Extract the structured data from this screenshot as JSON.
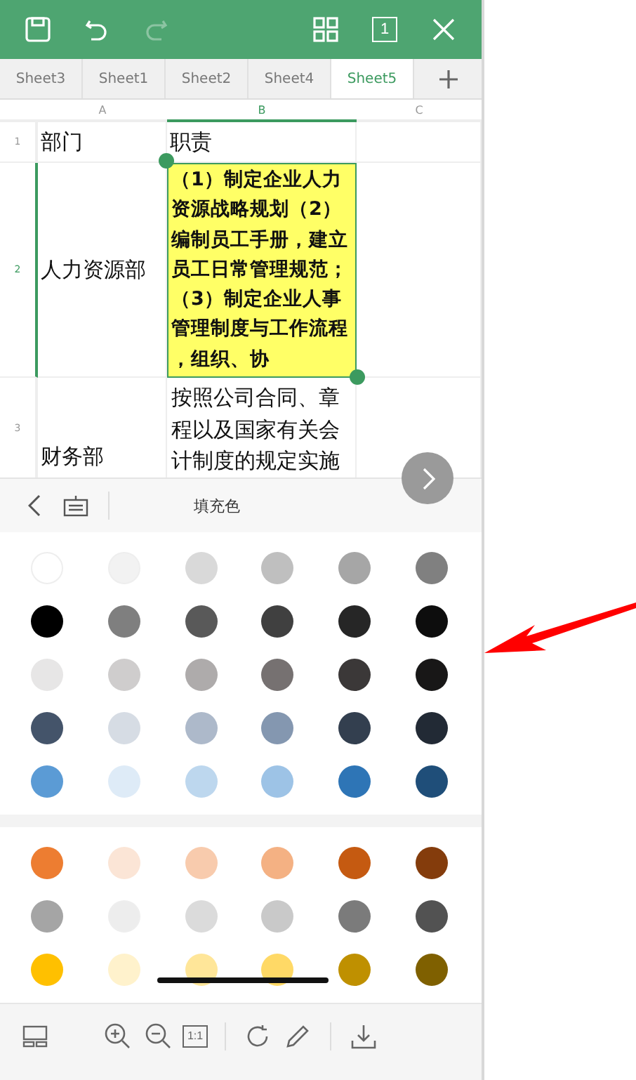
{
  "top_bar": {
    "buttons": [
      {
        "kind": "save",
        "disabled": false
      },
      {
        "kind": "undo",
        "disabled": false
      },
      {
        "kind": "redo",
        "disabled": true
      },
      {
        "kind": "grid",
        "disabled": false
      },
      {
        "kind": "page",
        "label": "1",
        "disabled": false
      },
      {
        "kind": "close",
        "disabled": false
      }
    ]
  },
  "sheet_tabs": [
    {
      "label": "Sheet3",
      "selected": false
    },
    {
      "label": "Sheet1",
      "selected": false
    },
    {
      "label": "Sheet2",
      "selected": false
    },
    {
      "label": "Sheet4",
      "selected": false
    },
    {
      "label": "Sheet5",
      "selected": true
    }
  ],
  "columns": [
    {
      "label": "A",
      "selected": false
    },
    {
      "label": "B",
      "selected": true
    },
    {
      "label": "C",
      "selected": false
    }
  ],
  "rows": [
    {
      "number": "1",
      "cells": [
        "部门",
        "职责",
        ""
      ],
      "selected": false
    },
    {
      "number": "2",
      "cells": [
        "人力资源部",
        "（1）制定企业人力资源战略规划（2）编制员工手册，建立员工日常管理规范；（3）制定企业人事管理制度与工作流程，组织、协",
        ""
      ],
      "selected": true
    },
    {
      "number": "3",
      "cells": [
        "财务部",
        "按照公司合同、章程以及国家有关会计制度的规定实施",
        ""
      ],
      "selected": false
    }
  ],
  "panel": {
    "title": "填充色"
  },
  "palettes": [
    {
      "swatches": [
        {
          "color": "#ffffff"
        },
        {
          "color": "#f2f2f2"
        },
        {
          "color": "#d9d9d9"
        },
        {
          "color": "#bfbfbf"
        },
        {
          "color": "#a6a6a6"
        },
        {
          "color": "#808080"
        },
        {
          "color": "#000000"
        },
        {
          "color": "#7f7f7f"
        },
        {
          "color": "#595959"
        },
        {
          "color": "#404040"
        },
        {
          "color": "#262626"
        },
        {
          "color": "#0d0d0d"
        },
        {
          "color": "#e7e6e6"
        },
        {
          "color": "#cfcdcd"
        },
        {
          "color": "#aeabab"
        },
        {
          "color": "#767171"
        },
        {
          "color": "#3b3838"
        },
        {
          "color": "#181717"
        },
        {
          "color": "#44546a"
        },
        {
          "color": "#d6dce4"
        },
        {
          "color": "#adb9ca"
        },
        {
          "color": "#8497b0"
        },
        {
          "color": "#333f4f"
        },
        {
          "color": "#222a35"
        },
        {
          "color": "#5b9bd5"
        },
        {
          "color": "#deebf7"
        },
        {
          "color": "#bdd7ee"
        },
        {
          "color": "#9dc3e6"
        },
        {
          "color": "#2e75b6"
        },
        {
          "color": "#1f4e79"
        }
      ]
    },
    {
      "swatches": [
        {
          "color": "#ed7d31"
        },
        {
          "color": "#fbe5d6"
        },
        {
          "color": "#f8cbad"
        },
        {
          "color": "#f4b183"
        },
        {
          "color": "#c55a11"
        },
        {
          "color": "#843c0c"
        },
        {
          "color": "#a5a5a5"
        },
        {
          "color": "#ededed"
        },
        {
          "color": "#dbdbdb"
        },
        {
          "color": "#c9c9c9"
        },
        {
          "color": "#7b7b7b"
        },
        {
          "color": "#525252"
        },
        {
          "color": "#ffc000"
        },
        {
          "color": "#fff2cc"
        },
        {
          "color": "#ffe699"
        },
        {
          "color": "#ffd966"
        },
        {
          "color": "#bf9000"
        },
        {
          "color": "#7f6000"
        }
      ]
    }
  ],
  "bottom_toolbar": [
    {
      "kind": "layout"
    },
    {
      "kind": "zoom-in"
    },
    {
      "kind": "zoom-out"
    },
    {
      "kind": "actual-size",
      "label": "1:1"
    },
    {
      "kind": "divider"
    },
    {
      "kind": "rotate"
    },
    {
      "kind": "pencil"
    },
    {
      "kind": "divider"
    },
    {
      "kind": "download"
    }
  ]
}
